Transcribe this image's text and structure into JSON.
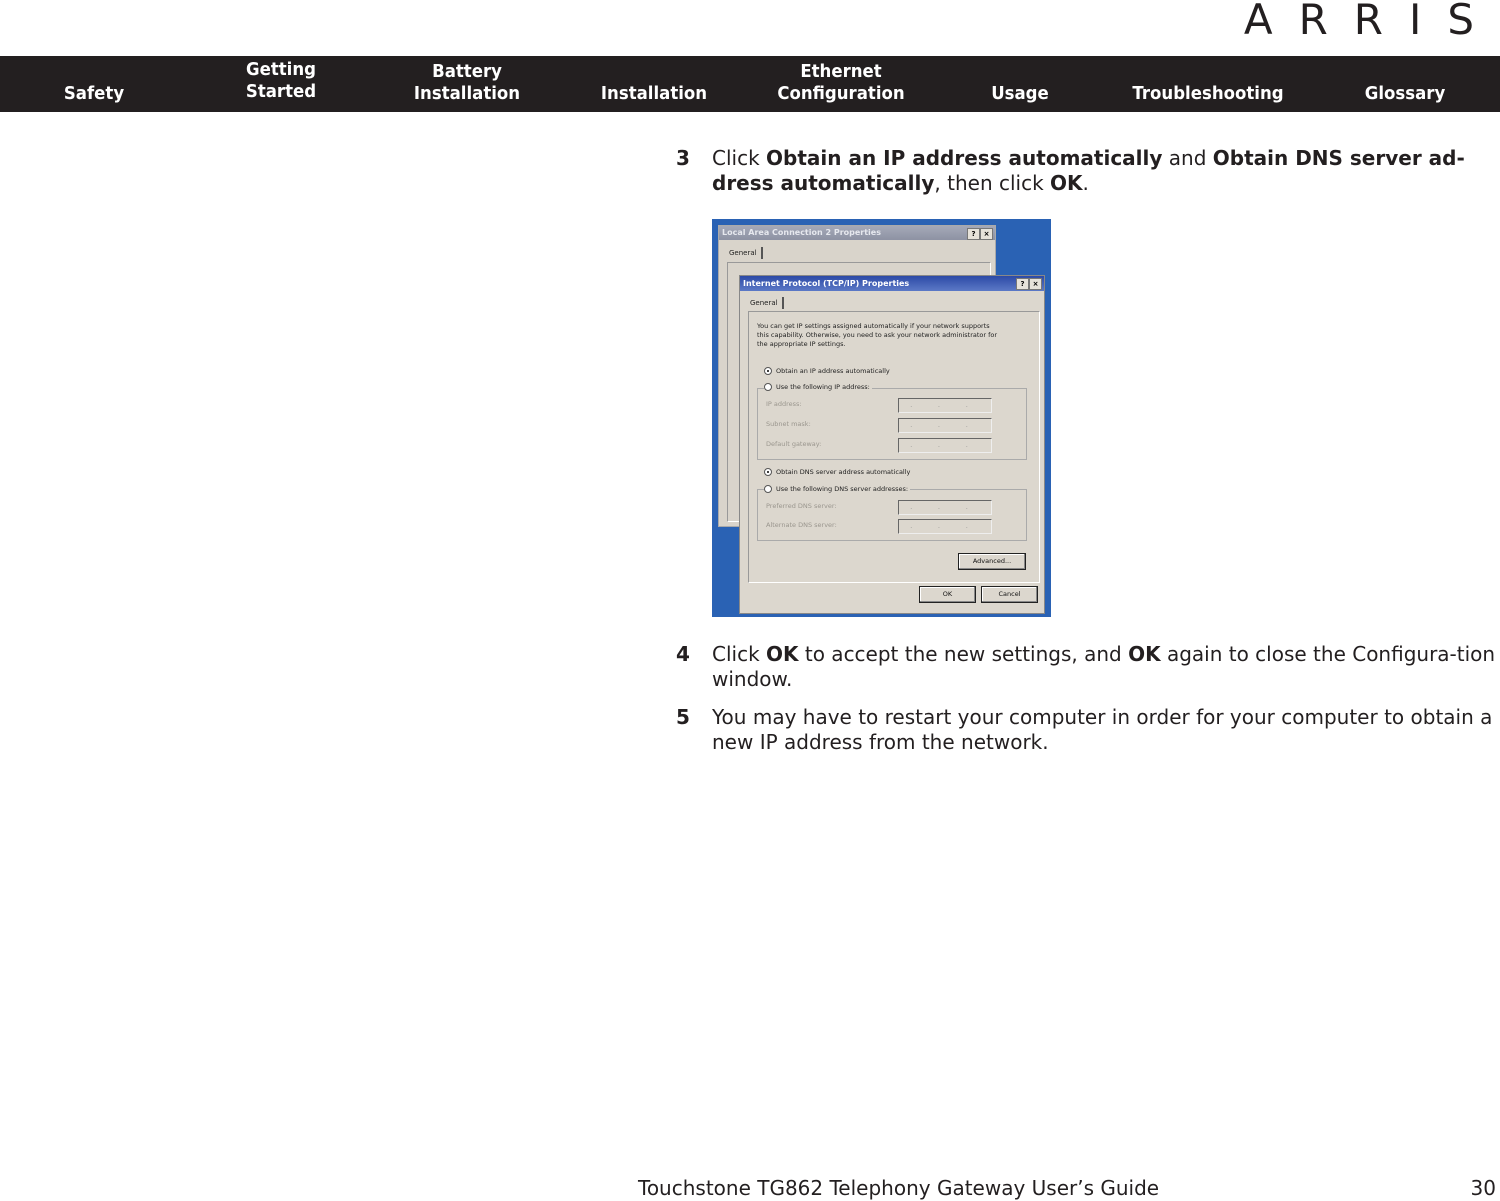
{
  "brand": {
    "logo_text": "ARRIS"
  },
  "nav": {
    "items": [
      {
        "id": "safety",
        "line1": "",
        "line2": "Safety"
      },
      {
        "id": "getting-started",
        "line1": "Getting",
        "line2": "Started"
      },
      {
        "id": "battery-installation",
        "line1": "Battery",
        "line2": "Installation"
      },
      {
        "id": "installation",
        "line1": "",
        "line2": "Installation"
      },
      {
        "id": "ethernet-configuration",
        "line1": "Ethernet",
        "line2": "Configuration"
      },
      {
        "id": "usage",
        "line1": "",
        "line2": "Usage"
      },
      {
        "id": "troubleshooting",
        "line1": "",
        "line2": "Troubleshooting"
      },
      {
        "id": "glossary",
        "line1": "",
        "line2": "Glossary"
      }
    ]
  },
  "steps": [
    {
      "number": "3",
      "parts": [
        {
          "t": "Click ",
          "b": false
        },
        {
          "t": "Obtain an IP address automatically",
          "b": true
        },
        {
          "t": " and ",
          "b": false
        },
        {
          "t": "Obtain DNS server ad-dress automatically",
          "b": true
        },
        {
          "t": ", then click ",
          "b": false
        },
        {
          "t": "OK",
          "b": true
        },
        {
          "t": ".",
          "b": false
        }
      ]
    },
    {
      "number": "4",
      "parts": [
        {
          "t": "Click ",
          "b": false
        },
        {
          "t": "OK",
          "b": true
        },
        {
          "t": " to accept the new settings, and ",
          "b": false
        },
        {
          "t": "OK",
          "b": true
        },
        {
          "t": " again to close the Configura-tion window.",
          "b": false
        }
      ]
    },
    {
      "number": "5",
      "parts": [
        {
          "t": "You may have to restart your computer in order for your computer to obtain a new IP address from the network.",
          "b": false
        }
      ]
    }
  ],
  "screenshot": {
    "back_window": {
      "title": "Local Area Connection 2 Properties",
      "tab": "General",
      "help": "?",
      "close": "×"
    },
    "front_window": {
      "title": "Internet Protocol (TCP/IP) Properties",
      "help": "?",
      "close": "×",
      "tab": "General",
      "intro_line1": "You can get IP settings assigned automatically if your network supports",
      "intro_line2": "this capability. Otherwise, you need to ask your network administrator for",
      "intro_line3": "the appropriate IP settings.",
      "radio_ip_auto": "Obtain an IP address automatically",
      "radio_ip_manual": "Use the following IP address:",
      "ip_label": "IP address:",
      "subnet_label": "Subnet mask:",
      "gateway_label": "Default gateway:",
      "radio_dns_auto": "Obtain DNS server address automatically",
      "radio_dns_manual": "Use the following DNS server addresses:",
      "preferred_dns_label": "Preferred DNS server:",
      "alternate_dns_label": "Alternate DNS server:",
      "ip_placeholder": ". . .",
      "advanced_button": "Advanced...",
      "ok_button": "OK",
      "cancel_button": "Cancel",
      "ip_auto_selected": true,
      "dns_auto_selected": true
    }
  },
  "footer": {
    "title": "Touchstone TG862 Telephony Gateway User’s Guide",
    "page": "30"
  }
}
